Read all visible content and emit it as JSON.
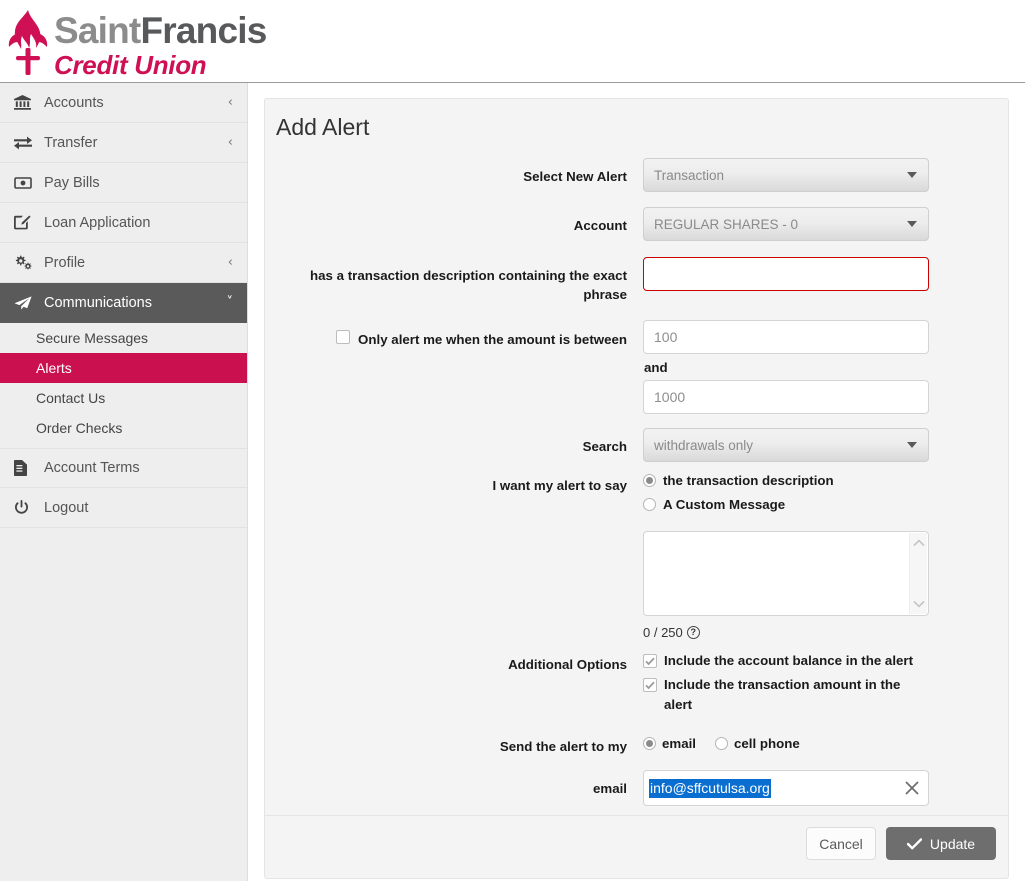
{
  "brand": {
    "name_part1": "Saint",
    "name_part2": "Francis",
    "tagline": "Credit Union",
    "accent_color": "#cb1050",
    "flame_color": "#cf1054"
  },
  "sidebar": {
    "items": [
      {
        "label": "Accounts",
        "icon": "bank-icon",
        "chevron": "‹",
        "state": "collapsed"
      },
      {
        "label": "Transfer",
        "icon": "exchange-icon",
        "chevron": "‹",
        "state": "collapsed"
      },
      {
        "label": "Pay Bills",
        "icon": "money-bill-icon",
        "chevron": "",
        "state": "none"
      },
      {
        "label": "Loan Application",
        "icon": "edit-square-icon",
        "chevron": "",
        "state": "none"
      },
      {
        "label": "Profile",
        "icon": "gears-icon",
        "chevron": "‹",
        "state": "collapsed"
      },
      {
        "label": "Communications",
        "icon": "paper-plane-icon",
        "chevron": "˅",
        "state": "expanded"
      }
    ],
    "sub_items": [
      {
        "label": "Secure Messages",
        "selected": false
      },
      {
        "label": "Alerts",
        "selected": true
      },
      {
        "label": "Contact Us",
        "selected": false
      },
      {
        "label": "Order Checks",
        "selected": false
      }
    ],
    "items_after": [
      {
        "label": "Account Terms",
        "icon": "document-icon",
        "chevron": "",
        "state": "none"
      },
      {
        "label": "Logout",
        "icon": "power-icon",
        "chevron": "",
        "state": "none"
      }
    ]
  },
  "page": {
    "title": "Add Alert"
  },
  "form": {
    "select_new_alert": {
      "label": "Select New Alert",
      "value": "Transaction",
      "disabled": true
    },
    "account": {
      "label": "Account",
      "value": "REGULAR SHARES - 0",
      "disabled": true
    },
    "phrase": {
      "label": "has a transaction description containing the exact phrase",
      "value": "",
      "placeholder": "",
      "error": true
    },
    "amount_between": {
      "label": "Only alert me when the amount is between",
      "checked": false,
      "min_placeholder": "100",
      "min_value": "",
      "and_label": "and",
      "max_placeholder": "1000",
      "max_value": ""
    },
    "search": {
      "label": "Search",
      "value": "withdrawals only",
      "disabled": true
    },
    "alert_say": {
      "label": "I want my alert to say",
      "options": [
        {
          "label": "the transaction description",
          "selected": true
        },
        {
          "label": "A Custom Message",
          "selected": false
        }
      ]
    },
    "custom_message": {
      "value": "",
      "counter": "0 / 250",
      "help_icon": "question-circle-icon"
    },
    "additional_options": {
      "label": "Additional Options",
      "options": [
        {
          "label": "Include the account balance in the alert",
          "checked": true
        },
        {
          "label": "Include the transaction amount in the alert",
          "checked": true
        }
      ]
    },
    "send_to": {
      "label": "Send the alert to my",
      "options": [
        {
          "label": "email",
          "selected": true
        },
        {
          "label": "cell phone",
          "selected": false
        }
      ]
    },
    "email": {
      "label": "email",
      "value": "info@sffcutulsa.org",
      "selected_text": true,
      "clear_icon": "close-icon"
    }
  },
  "actions": {
    "cancel_label": "Cancel",
    "update_label": "Update",
    "update_icon": "check-icon"
  }
}
